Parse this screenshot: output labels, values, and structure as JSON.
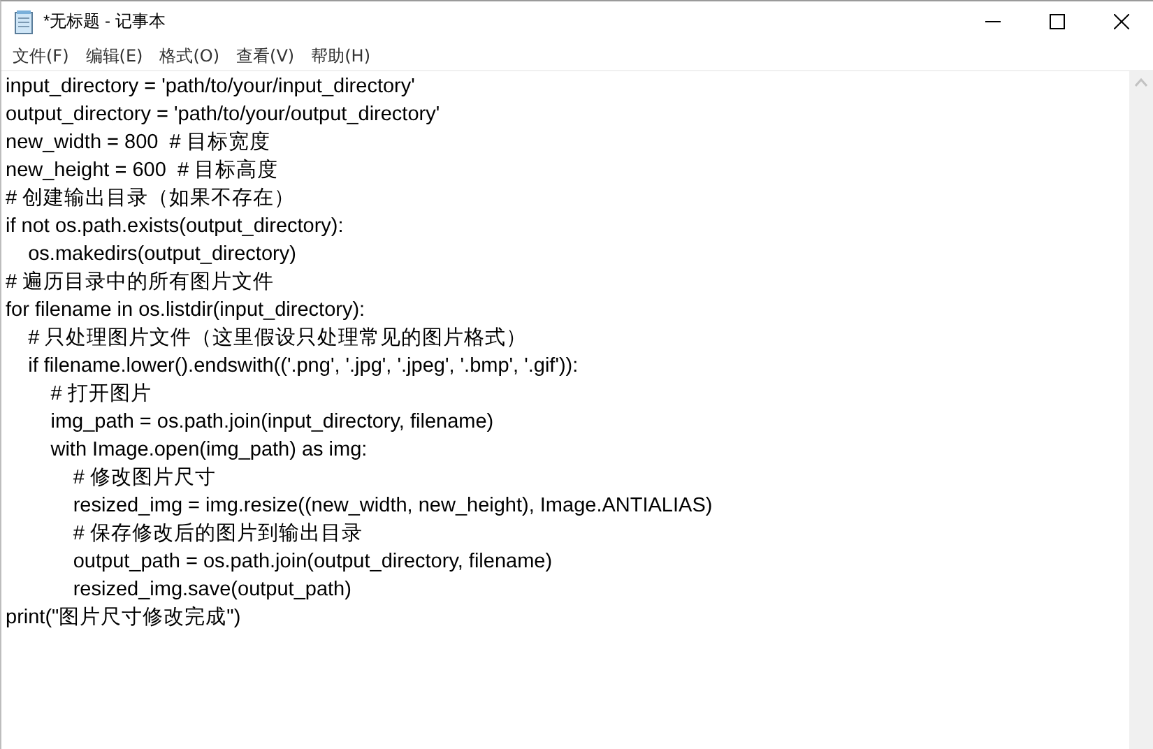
{
  "window": {
    "title": "*无标题 - 记事本"
  },
  "menu": [
    "文件(F)",
    "编辑(E)",
    "格式(O)",
    "查看(V)",
    "帮助(H)"
  ],
  "editor": {
    "lines": [
      "input_directory = 'path/to/your/input_directory'",
      "output_directory = 'path/to/your/output_directory'",
      "new_width = 800  # 目标宽度",
      "new_height = 600  # 目标高度",
      "# 创建输出目录（如果不存在）",
      "if not os.path.exists(output_directory):",
      "    os.makedirs(output_directory)",
      "# 遍历目录中的所有图片文件",
      "for filename in os.listdir(input_directory):",
      "    # 只处理图片文件（这里假设只处理常见的图片格式）",
      "    if filename.lower().endswith(('.png', '.jpg', '.jpeg', '.bmp', '.gif')):",
      "        # 打开图片",
      "        img_path = os.path.join(input_directory, filename)",
      "        with Image.open(img_path) as img:",
      "            # 修改图片尺寸",
      "            resized_img = img.resize((new_width, new_height), Image.ANTIALIAS)",
      "            # 保存修改后的图片到输出目录",
      "            output_path = os.path.join(output_directory, filename)",
      "            resized_img.save(output_path)",
      "print(\"图片尺寸修改完成\")"
    ]
  }
}
